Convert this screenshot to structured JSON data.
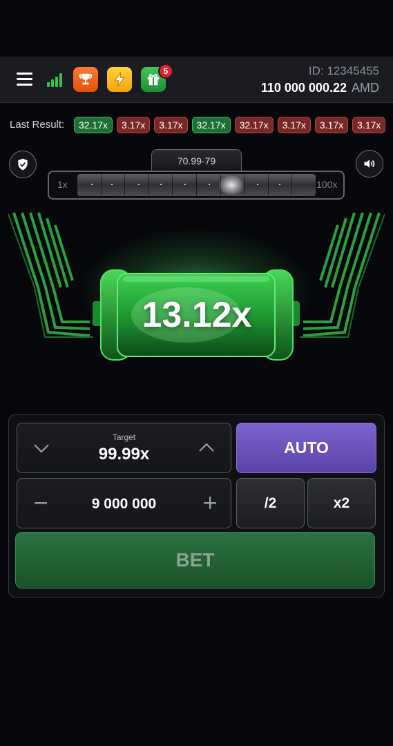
{
  "header": {
    "user_id": "ID: 12345455",
    "balance": "110 000 000.22",
    "currency": "AMD",
    "gift_badge_count": "5",
    "icons": [
      "menu-icon",
      "signal-icon",
      "trophy-icon",
      "lightning-icon",
      "gift-icon"
    ]
  },
  "last_results": {
    "label": "Last Result:",
    "items": [
      {
        "value": "32.17x",
        "status": "green"
      },
      {
        "value": "3.17x",
        "status": "red"
      },
      {
        "value": "3.17x",
        "status": "red"
      },
      {
        "value": "32.17x",
        "status": "green"
      },
      {
        "value": "32.17x",
        "status": "red"
      },
      {
        "value": "3.17x",
        "status": "red"
      },
      {
        "value": "3.17x",
        "status": "red"
      },
      {
        "value": "3.17x",
        "status": "red"
      }
    ]
  },
  "game": {
    "range_label": "70.99-79",
    "range_min": "1x",
    "range_max": "100x",
    "multiplier": "13.12x"
  },
  "bet_panel": {
    "target_label": "Target",
    "target_value": "99.99x",
    "amount_value": "9 000 000",
    "auto_label": "AUTO",
    "half_label": "/2",
    "double_label": "x2",
    "bet_label": "BET"
  },
  "colors": {
    "accent_green": "#35c247",
    "auto_purple": "#6a52bd",
    "result_green": "#1f6f34",
    "result_red": "#7a2727"
  }
}
